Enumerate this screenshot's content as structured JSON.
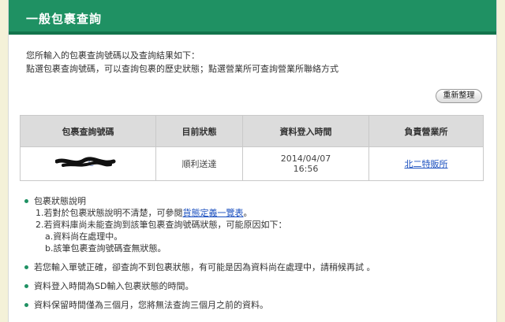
{
  "header": {
    "title": "一般包裹查詢"
  },
  "intro": {
    "line1": "您所輸入的包裹查詢號碼以及查詢結果如下：",
    "line2": "點選包裹查詢號碼，可以查詢包裹的歷史狀態；點選營業所可查詢營業所聯絡方式"
  },
  "reset_button": "重新整理",
  "table": {
    "headers": [
      "包裹查詢號碼",
      "目前狀態",
      "資料登入時間",
      "負責營業所"
    ],
    "row": {
      "tracking_visible": "C",
      "status": "順利送達",
      "date": "2014/04/07",
      "time": "16:56",
      "office": "北二特販所"
    }
  },
  "notes": {
    "status_title": "包裹狀態說明",
    "item1_prefix": "1.若對於包裹狀態說明不清楚，可參閱",
    "item1_link": "貨態定義一覽表",
    "item1_suffix": "。",
    "item2": "2.若資料庫尚未能查詢到該筆包裹查詢號碼狀態，可能原因如下：",
    "item2a": "a.資料尚在處理中。",
    "item2b": "b.該筆包裹查詢號碼查無狀態。",
    "note2": "若您輸入單號正確，卻查詢不到包裹狀態，有可能是因為資料尚在處理中，請稍候再試 。",
    "note3": "資料登入時間為SD輸入包裹狀態的時間。",
    "note4": "資料保留時間僅為三個月，您將無法查詢三個月之前的資料。"
  },
  "colors": {
    "brand_green": "#1f9163",
    "status_red": "#d81e1e",
    "link_blue": "#1a4fbf"
  }
}
